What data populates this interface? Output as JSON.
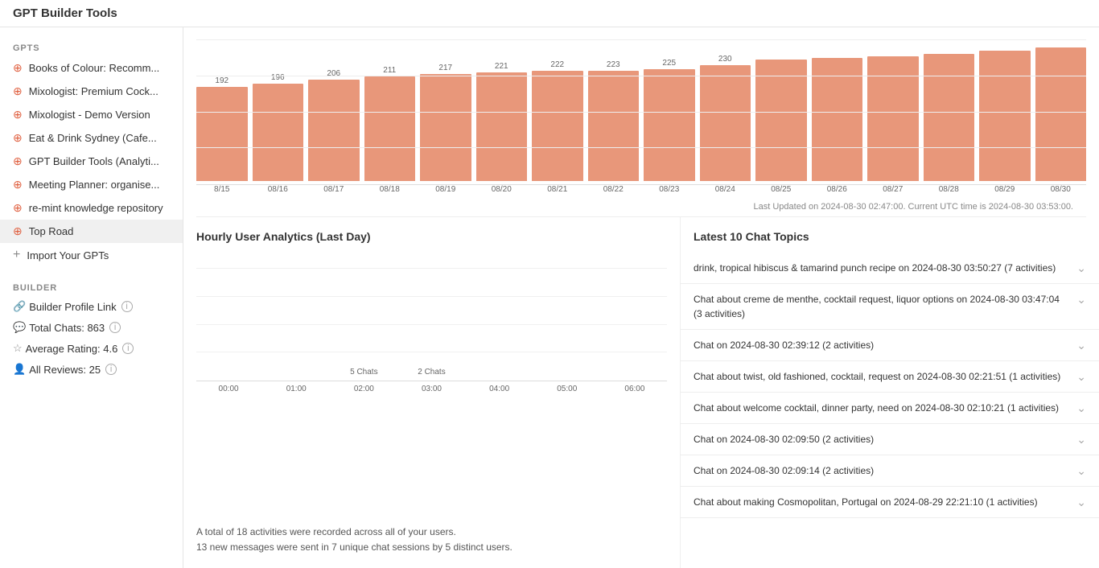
{
  "header": {
    "title": "GPT Builder Tools"
  },
  "sidebar": {
    "gpts_label": "GPTS",
    "builder_label": "BUILDER",
    "gpt_items": [
      {
        "label": "Books of Colour: Recomm...",
        "id": "books-of-colour"
      },
      {
        "label": "Mixologist: Premium Cock...",
        "id": "mixologist-premium"
      },
      {
        "label": "Mixologist - Demo Version",
        "id": "mixologist-demo"
      },
      {
        "label": "Eat & Drink Sydney (Cafe...",
        "id": "eat-drink-sydney"
      },
      {
        "label": "GPT Builder Tools (Analyti...",
        "id": "gpt-builder-tools"
      },
      {
        "label": "Meeting Planner: organise...",
        "id": "meeting-planner"
      },
      {
        "label": "re-mint knowledge repository",
        "id": "re-mint"
      },
      {
        "label": "Top Road",
        "id": "top-road",
        "active": true
      }
    ],
    "import_label": "Import Your GPTs",
    "builder_items": [
      {
        "label": "Builder Profile Link",
        "has_info": true
      },
      {
        "label": "Total Chats: 863",
        "has_info": true
      },
      {
        "label": "Average Rating: 4.6",
        "has_info": true
      },
      {
        "label": "All Reviews: 25",
        "has_info": true
      }
    ]
  },
  "bar_chart": {
    "bars": [
      {
        "value": "192",
        "label": "8/15",
        "height_pct": 65
      },
      {
        "value": "196",
        "label": "08/16",
        "height_pct": 67
      },
      {
        "value": "206",
        "label": "08/17",
        "height_pct": 70
      },
      {
        "value": "211",
        "label": "08/18",
        "height_pct": 72
      },
      {
        "value": "217",
        "label": "08/19",
        "height_pct": 74
      },
      {
        "value": "221",
        "label": "08/20",
        "height_pct": 75
      },
      {
        "value": "222",
        "label": "08/21",
        "height_pct": 76
      },
      {
        "value": "223",
        "label": "08/22",
        "height_pct": 76
      },
      {
        "value": "225",
        "label": "08/23",
        "height_pct": 77
      },
      {
        "value": "230",
        "label": "08/24",
        "height_pct": 80
      },
      {
        "value": "",
        "label": "08/25",
        "height_pct": 84
      },
      {
        "value": "",
        "label": "08/26",
        "height_pct": 85
      },
      {
        "value": "",
        "label": "08/27",
        "height_pct": 86
      },
      {
        "value": "",
        "label": "08/28",
        "height_pct": 88
      },
      {
        "value": "",
        "label": "08/29",
        "height_pct": 90
      },
      {
        "value": "",
        "label": "08/30",
        "height_pct": 92
      }
    ],
    "update_notice": "Last Updated on 2024-08-30 02:47:00. Current UTC time is 2024-08-30 03:53:00."
  },
  "hourly_panel": {
    "title": "Hourly User Analytics (Last Day)",
    "bars": [
      {
        "label": "00:00",
        "value": "",
        "height_pct": 0
      },
      {
        "label": "01:00",
        "value": "",
        "height_pct": 0
      },
      {
        "label": "02:00",
        "value": "5 Chats",
        "height_pct": 75
      },
      {
        "label": "03:00",
        "value": "2 Chats",
        "height_pct": 30
      },
      {
        "label": "04:00",
        "value": "",
        "height_pct": 8
      },
      {
        "label": "05:00",
        "value": "",
        "height_pct": 5
      },
      {
        "label": "06:00",
        "value": "",
        "height_pct": 3
      }
    ],
    "summary_line1": "A total of 18 activities were recorded across all of your users.",
    "summary_line2": "13 new messages were sent in 7 unique chat sessions by 5 distinct users."
  },
  "topics_panel": {
    "title": "Latest 10 Chat Topics",
    "topics": [
      {
        "text": "drink, tropical hibiscus & tamarind punch recipe on 2024-08-30 03:50:27 (7 activities)"
      },
      {
        "text": "Chat about creme de menthe, cocktail request, liquor options on 2024-08-30 03:47:04 (3 activities)"
      },
      {
        "text": "Chat on 2024-08-30 02:39:12 (2 activities)"
      },
      {
        "text": "Chat about twist, old fashioned, cocktail, request on 2024-08-30 02:21:51 (1 activities)"
      },
      {
        "text": "Chat about welcome cocktail, dinner party, need on 2024-08-30 02:10:21 (1 activities)"
      },
      {
        "text": "Chat on 2024-08-30 02:09:50 (2 activities)"
      },
      {
        "text": "Chat on 2024-08-30 02:09:14 (2 activities)"
      },
      {
        "text": "Chat about making Cosmopolitan, Portugal on 2024-08-29 22:21:10 (1 activities)"
      }
    ]
  }
}
